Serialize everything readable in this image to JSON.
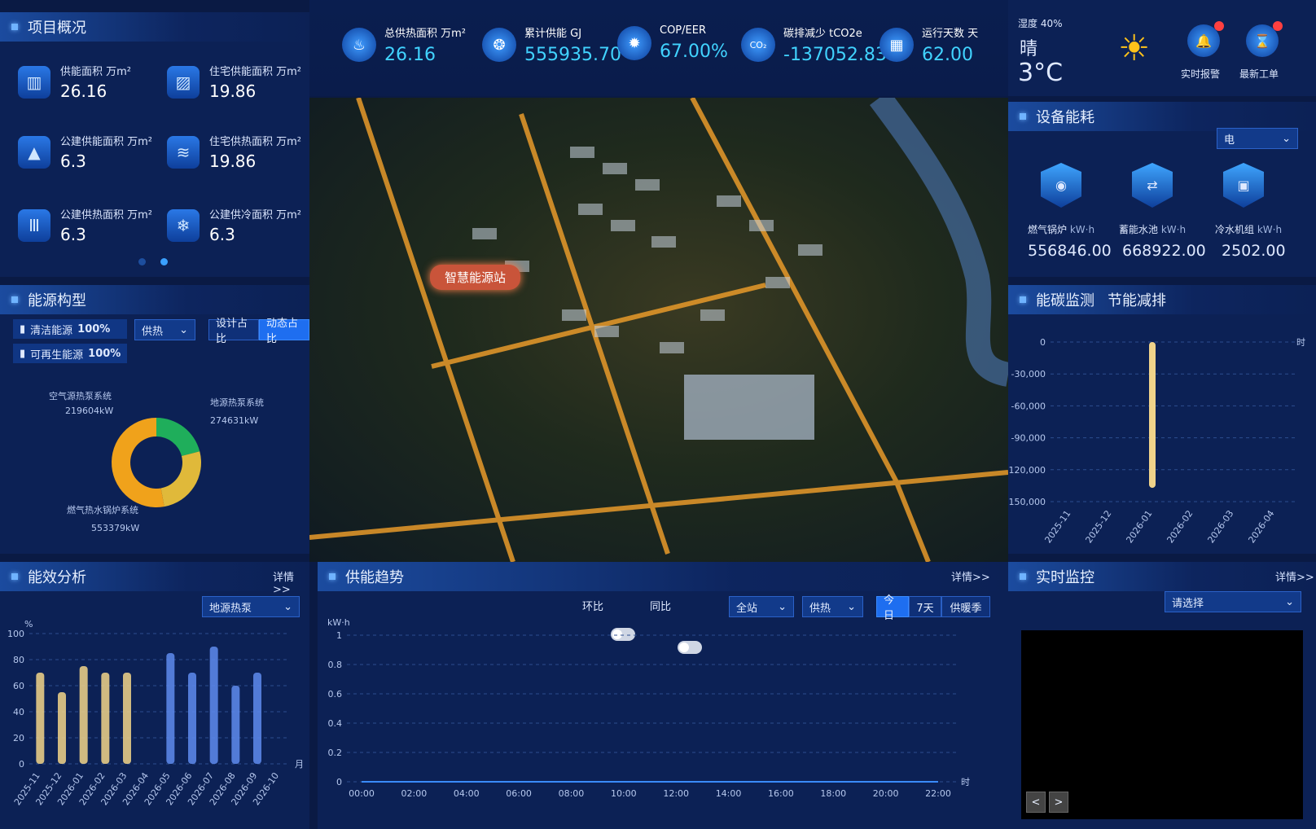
{
  "overview": {
    "title": "项目概况",
    "tiles": [
      {
        "label": "供能面积 万m²",
        "value": "26.16",
        "icon": "building-icon"
      },
      {
        "label": "住宅供能面积 万m²",
        "value": "19.86",
        "icon": "radiator-icon"
      },
      {
        "label": "公建供能面积 万m²",
        "value": "6.3",
        "icon": "tower-icon"
      },
      {
        "label": "住宅供热面积 万m²",
        "value": "19.86",
        "icon": "heat-wave-icon"
      },
      {
        "label": "公建供热面积 万m²",
        "value": "6.3",
        "icon": "heater-icon"
      },
      {
        "label": "公建供冷面积 万m²",
        "value": "6.3",
        "icon": "snowflake-icon"
      }
    ]
  },
  "kpis": [
    {
      "label": "总供热面积 万m²",
      "value": "26.16",
      "icon": "heating-icon"
    },
    {
      "label": "累计供能 GJ",
      "value": "555935.70",
      "icon": "energy-drop-icon"
    },
    {
      "label": "COP/EER",
      "value": "67.00%",
      "icon": "sun-snow-icon"
    },
    {
      "label": "碳排减少 tCO2e",
      "value": "-137052.83",
      "icon": "co2-cloud-icon"
    },
    {
      "label": "运行天数 天",
      "value": "62.00",
      "icon": "calendar-icon"
    }
  ],
  "weather": {
    "humidity": "湿度 40%",
    "condition": "晴",
    "temp": "3°C",
    "alarm": "实时报警",
    "workorder": "最新工单"
  },
  "device": {
    "title": "设备能耗",
    "select": "电",
    "items": [
      {
        "label": "燃气锅炉",
        "unit": "kW·h",
        "value": "556846.00"
      },
      {
        "label": "蓄能水池",
        "unit": "kW·h",
        "value": "668922.00"
      },
      {
        "label": "冷水机组",
        "unit": "kW·h",
        "value": "2502.00"
      }
    ]
  },
  "structure": {
    "title": "能源构型",
    "clean": "清洁能源",
    "clean_pct": "100%",
    "renew": "可再生能源",
    "renew_pct": "100%",
    "select": "供热",
    "btn_design": "设计占比",
    "btn_dynamic": "动态占比",
    "slices": [
      {
        "name": "空气源热泵系统",
        "value": "219604kW",
        "num": 219604,
        "color": "#1fae5b"
      },
      {
        "name": "地源热泵系统",
        "value": "274631kW",
        "num": 274631,
        "color": "#e0b93a"
      },
      {
        "name": "燃气热水锅炉系统",
        "value": "553379kW",
        "num": 553379,
        "color": "#f0a21b"
      }
    ]
  },
  "map": {
    "station": "智慧能源站"
  },
  "carbon": {
    "title": "能碳监测",
    "title2": "节能减排",
    "unit": "时"
  },
  "efficiency": {
    "title": "能效分析",
    "detail": "详情>>",
    "select": "地源热泵",
    "yunit": "%",
    "xunit": "月"
  },
  "trend": {
    "title": "供能趋势",
    "detail": "详情>>",
    "hb": "环比",
    "tb": "同比",
    "sel1": "全站",
    "sel2": "供热",
    "b_today": "今日",
    "b_7": "7天",
    "b_season": "供暖季",
    "yunit": "kW·h",
    "xunit": "时"
  },
  "monitor": {
    "title": "实时监控",
    "detail": "详情>>",
    "select": "请选择",
    "prev": "<",
    "next": ">"
  },
  "chart_data": [
    {
      "type": "bar",
      "title": "能效分析",
      "ylabel": "%",
      "xlabel": "月",
      "ylim": [
        0,
        100
      ],
      "categories": [
        "2025-11",
        "2025-12",
        "2026-01",
        "2026-02",
        "2026-03",
        "2026-04",
        "2026-05",
        "2026-06",
        "2026-07",
        "2026-08",
        "2026-09",
        "2026-10"
      ],
      "values": [
        70,
        55,
        75,
        70,
        70,
        null,
        85,
        70,
        90,
        60,
        70,
        null
      ],
      "yticks": [
        "0",
        "20",
        "40",
        "60",
        "80",
        "100"
      ]
    },
    {
      "type": "bar",
      "title": "能碳监测",
      "xlabel": "时",
      "ylim": [
        -150000,
        0
      ],
      "categories": [
        "2025-11",
        "2025-12",
        "2026-01",
        "2026-02",
        "2026-03",
        "2026-04"
      ],
      "values": [
        0,
        0,
        -137052.83,
        0,
        0,
        0
      ],
      "yticks": [
        "0",
        "-30,000",
        "-60,000",
        "-90,000",
        "-120,000",
        "-150,000"
      ]
    },
    {
      "type": "line",
      "title": "供能趋势",
      "ylabel": "kW·h",
      "xlabel": "时",
      "ylim": [
        0,
        1
      ],
      "categories": [
        "00:00",
        "02:00",
        "04:00",
        "06:00",
        "08:00",
        "10:00",
        "12:00",
        "14:00",
        "16:00",
        "18:00",
        "20:00",
        "22:00"
      ],
      "values": [
        0,
        0,
        0,
        0,
        0,
        0,
        0,
        0,
        0,
        0,
        0,
        0
      ],
      "yticks": [
        "0",
        "0.2",
        "0.4",
        "0.6",
        "0.8",
        "1"
      ]
    }
  ]
}
